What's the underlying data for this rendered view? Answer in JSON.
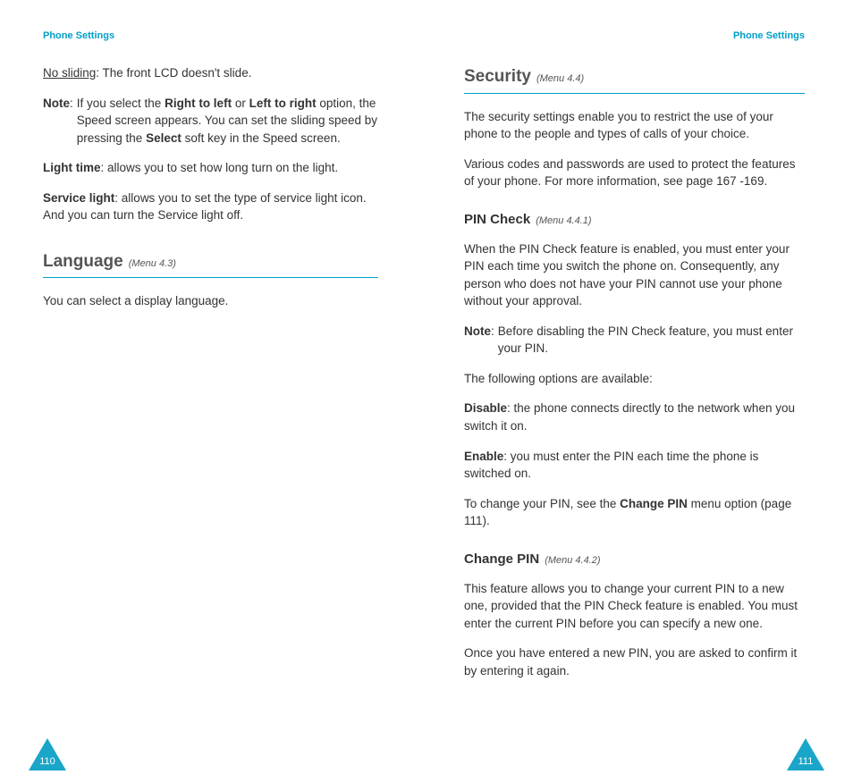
{
  "left": {
    "header": "Phone Settings",
    "no_sliding_label": "No sliding",
    "no_sliding_text": ": The front LCD doesn't slide.",
    "note_label": "Note",
    "note_colon": ": ",
    "note_pre": "If you select the ",
    "note_rtl": "Right to left",
    "note_or": " or ",
    "note_ltr": "Left to right",
    "note_mid": " option, the Speed screen appears. You can set the sliding speed by pressing the ",
    "note_select": "Select",
    "note_post": " soft key in the Speed screen.",
    "light_time_label": "Light time",
    "light_time_text": ": allows you to set how long turn on the light.",
    "service_light_label": "Service light",
    "service_light_text": ": allows you to set the type of service light icon. And you can turn the Service light off.",
    "language_title": "Language",
    "language_menu": "(Menu 4.3)",
    "language_body": "You can select a display language.",
    "page_number": "110"
  },
  "right": {
    "header": "Phone Settings",
    "security_title": "Security",
    "security_menu": "(Menu 4.4)",
    "security_p1": "The security settings enable you to restrict the use of your phone to the people and types of calls of your choice.",
    "security_p2": "Various codes and passwords are used to protect the features of your phone. For more information, see page 167 -169.",
    "pin_check_title": "PIN Check",
    "pin_check_menu": "(Menu 4.4.1)",
    "pin_check_p1": "When the PIN Check feature is enabled, you must enter your PIN each time you switch the phone on. Consequently, any person who does not have your PIN cannot use your phone without your approval.",
    "pin_note_label": "Note",
    "pin_note_colon": ": ",
    "pin_note_text": "Before disabling the PIN Check feature, you must enter your PIN.",
    "pin_options_intro": "The following options are available:",
    "disable_label": "Disable",
    "disable_text": ": the phone connects directly to the network when you switch it on.",
    "enable_label": "Enable",
    "enable_text": ": you must enter the PIN each time the phone is switched on.",
    "change_ref_pre": "To change your PIN, see the ",
    "change_ref_bold": "Change PIN",
    "change_ref_post": " menu option (page 111).",
    "change_pin_title": "Change PIN",
    "change_pin_menu": "(Menu 4.4.2)",
    "change_pin_p1": "This feature allows you to change your current PIN to a new one, provided that the PIN Check feature is enabled. You must enter the current PIN before you can specify a new one.",
    "change_pin_p2": "Once you have entered a new PIN, you are asked to confirm it by entering it again.",
    "page_number": "111"
  }
}
